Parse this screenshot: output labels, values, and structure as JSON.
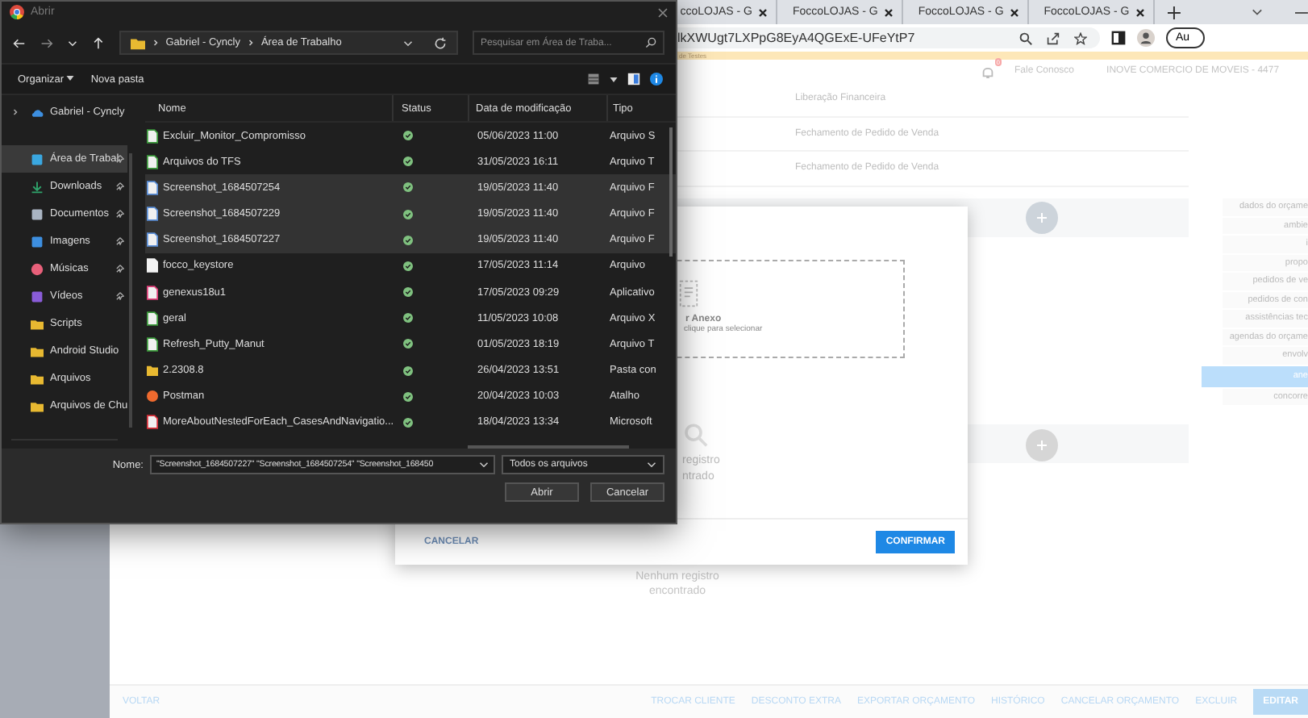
{
  "browser": {
    "tabs": [
      {
        "label": "ccoLOJAS - G"
      },
      {
        "label": "FoccoLOJAS - G"
      },
      {
        "label": "FoccoLOJAS - G"
      },
      {
        "label": "FoccoLOJAS - G"
      }
    ],
    "address": "lkXWUgt7LXPpG8EyA4QGExE-UFeYtP7",
    "profile_button": "Au",
    "banner": "de Testes"
  },
  "page": {
    "notification_count": "0",
    "contact_link": "Fale Conosco",
    "company": "INOVE COMERCIO DE MOVEIS - 4477",
    "rows": [
      "Liberação Financeira",
      "Fechamento de Pedido de Venda",
      "Fechamento de Pedido de Venda"
    ],
    "empty_text": "Nenhum registro encontrado",
    "nav": [
      {
        "label": "dados do orçame",
        "selected": false
      },
      {
        "label": "ambie",
        "selected": false
      },
      {
        "label": "i",
        "selected": false
      },
      {
        "label": "propo",
        "selected": false
      },
      {
        "label": "pedidos de ve",
        "selected": false
      },
      {
        "label": "pedidos de con",
        "selected": false
      },
      {
        "label": "assistências tec",
        "selected": false
      },
      {
        "label": "agendas do orçame",
        "selected": false
      },
      {
        "label": "envolv",
        "selected": false
      },
      {
        "label": "ane",
        "selected": true
      },
      {
        "label": "concorre",
        "selected": false
      }
    ],
    "actions": [
      {
        "label": "VOLTAR",
        "kind": "back"
      },
      {
        "label": "TROCAR CLIENTE",
        "kind": "action"
      },
      {
        "label": "DESCONTO EXTRA",
        "kind": "action"
      },
      {
        "label": "EXPORTAR ORÇAMENTO",
        "kind": "action"
      },
      {
        "label": "HISTÓRICO",
        "kind": "action"
      },
      {
        "label": "CANCELAR ORÇAMENTO",
        "kind": "action"
      },
      {
        "label": "EXCLUIR",
        "kind": "action"
      },
      {
        "label": "EDITAR",
        "kind": "primary"
      }
    ]
  },
  "modal": {
    "drop_title": "r Anexo",
    "drop_hint": "clique para selecionar",
    "empty_text": [
      "registro",
      "ntrado"
    ],
    "cancel": "CANCELAR",
    "confirm": "CONFIRMAR"
  },
  "dialog": {
    "title": "Abrir",
    "path": [
      "Gabriel - Cyncly",
      "Área de Trabalho"
    ],
    "search": {
      "placeholder": "Pesquisar em Área de Traba..."
    },
    "toolbar": [
      "Organizar",
      "Nova pasta"
    ],
    "sidebar": [
      {
        "label": "Gabriel - Cyncly",
        "kind": "cloud",
        "pinned": false,
        "selected": false
      },
      {
        "label": "Área de Trabal",
        "kind": "desktop",
        "pinned": true,
        "selected": true
      },
      {
        "label": "Downloads",
        "kind": "download",
        "pinned": true,
        "selected": false
      },
      {
        "label": "Documentos",
        "kind": "documents",
        "pinned": true,
        "selected": false
      },
      {
        "label": "Imagens",
        "kind": "pictures",
        "pinned": true,
        "selected": false
      },
      {
        "label": "Músicas",
        "kind": "music",
        "pinned": true,
        "selected": false
      },
      {
        "label": "Vídeos",
        "kind": "videos",
        "pinned": true,
        "selected": false
      },
      {
        "label": "Scripts",
        "kind": "folder",
        "pinned": false,
        "selected": false
      },
      {
        "label": "Android Studio",
        "kind": "folder",
        "pinned": false,
        "selected": false
      },
      {
        "label": "Arquivos",
        "kind": "folder",
        "pinned": false,
        "selected": false
      },
      {
        "label": "Arquivos de Chu",
        "kind": "folder",
        "pinned": false,
        "selected": false
      }
    ],
    "columns": [
      "Nome",
      "Status",
      "Data de modificação",
      "Tipo"
    ],
    "files": [
      {
        "name": "Excluir_Monitor_Compromisso",
        "kind": "sheet",
        "date": "05/06/2023 11:00",
        "type": "Arquivo S",
        "selected": false
      },
      {
        "name": "Arquivos do TFS",
        "kind": "sheet",
        "date": "31/05/2023 16:11",
        "type": "Arquivo T",
        "selected": false
      },
      {
        "name": "Screenshot_1684507254",
        "kind": "image",
        "date": "19/05/2023 11:40",
        "type": "Arquivo F",
        "selected": true
      },
      {
        "name": "Screenshot_1684507229",
        "kind": "image",
        "date": "19/05/2023 11:40",
        "type": "Arquivo F",
        "selected": true
      },
      {
        "name": "Screenshot_1684507227",
        "kind": "image",
        "date": "19/05/2023 11:40",
        "type": "Arquivo F",
        "selected": true
      },
      {
        "name": "focco_keystore",
        "kind": "doc",
        "date": "17/05/2023 11:14",
        "type": "Arquivo",
        "selected": false
      },
      {
        "name": "genexus18u1",
        "kind": "app",
        "date": "17/05/2023 09:29",
        "type": "Aplicativo",
        "selected": false
      },
      {
        "name": "geral",
        "kind": "sheet",
        "date": "11/05/2023 10:08",
        "type": "Arquivo X",
        "selected": false
      },
      {
        "name": "Refresh_Putty_Manut",
        "kind": "sheet",
        "date": "01/05/2023 18:19",
        "type": "Arquivo T",
        "selected": false
      },
      {
        "name": "2.2308.8",
        "kind": "folder",
        "date": "26/04/2023 13:51",
        "type": "Pasta con",
        "selected": false
      },
      {
        "name": "Postman",
        "kind": "postman",
        "date": "20/04/2023 10:03",
        "type": "Atalho",
        "selected": false
      },
      {
        "name": "MoreAboutNestedForEach_CasesAndNavigatio...",
        "kind": "pdf",
        "date": "18/04/2023 13:34",
        "type": "Microsoft",
        "selected": false
      }
    ],
    "filename_label": "Nome:",
    "filename": "\"Screenshot_1684507227\" \"Screenshot_1684507254\" \"Screenshot_168450",
    "filter": "Todos os arquivos",
    "open_button": "Abrir",
    "cancel_button": "Cancelar"
  }
}
